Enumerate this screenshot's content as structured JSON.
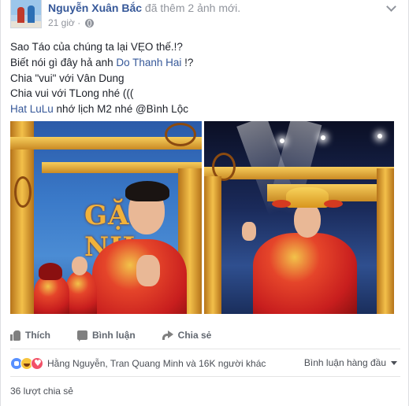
{
  "post": {
    "author": "Nguyễn Xuân Bắc",
    "action": "đã thêm 2 ảnh mới.",
    "time": "21 giờ ·",
    "privacy_icon": "globe-icon",
    "menu_icon": "chevron-down-icon"
  },
  "text": {
    "line1": "Sao Táo của chúng ta lại VẸO thế.!?",
    "line2_prefix": "Biết nói gì đây hả anh ",
    "line2_link": "Do Thanh Hai",
    "line2_suffix": " !?",
    "line3": "Chia \"vui\" với Vân Dung",
    "line4": "Chia vui với TLong nhé (((",
    "line5_link": "Hat LuLu",
    "line5_suffix": " nhớ lịch M2 nhé @Bình Lộc"
  },
  "photos": {
    "sign_text": "GẶP NH"
  },
  "actions": {
    "like": "Thích",
    "comment": "Bình luận",
    "share": "Chia sẻ"
  },
  "reactions": {
    "icons": [
      "like-icon",
      "haha-icon",
      "love-icon"
    ],
    "summary": "Hằng Nguyễn, Tran Quang Minh và 16K người khác",
    "sort_label": "Bình luận hàng đầu"
  },
  "shares": {
    "count_text": "36 lượt chia sẻ"
  },
  "colors": {
    "link": "#365899",
    "muted": "#90949c",
    "like_blue": "#5890ff",
    "love_red": "#f25268",
    "haha_yellow": "#f7c43d"
  }
}
